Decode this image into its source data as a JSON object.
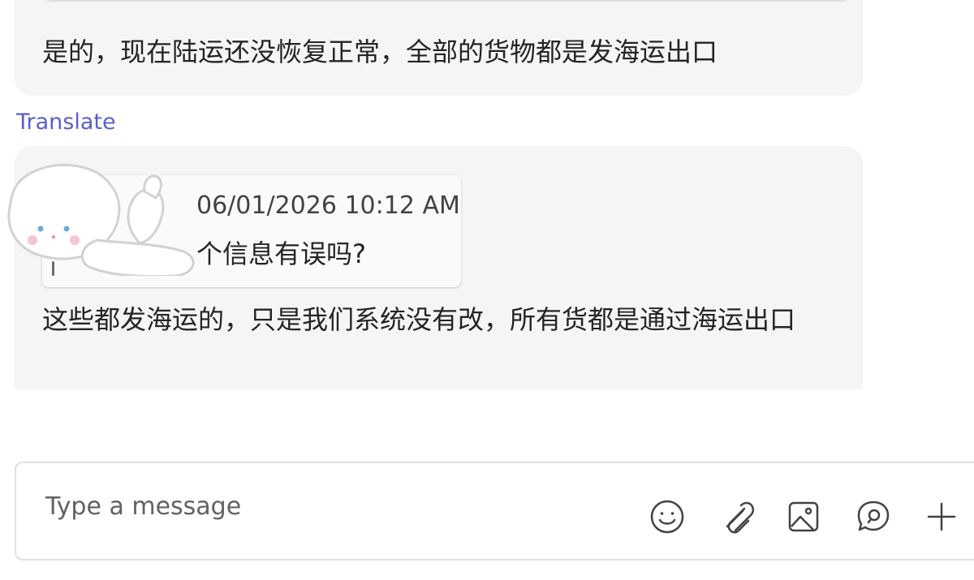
{
  "messages": [
    {
      "text": "是的，现在陆运还没恢复正常，全部的货物都是发海运出口",
      "translate_label": "Translate"
    },
    {
      "quoted": {
        "timestamp": "06/01/2026 10:12 AM",
        "text": "个信息有误吗?"
      },
      "text": "这些都发海运的，只是我们系统没有改，所有货都是通过海运出口"
    }
  ],
  "composer": {
    "placeholder": "Type a message",
    "tools": [
      {
        "icon": "emoji-icon"
      },
      {
        "icon": "paperclip-icon"
      },
      {
        "icon": "image-icon"
      },
      {
        "icon": "loop-icon"
      },
      {
        "icon": "plus-icon"
      }
    ]
  },
  "colors": {
    "bubble_bg": "#f5f5f5",
    "link": "#5b5fc7",
    "text": "#242424"
  }
}
